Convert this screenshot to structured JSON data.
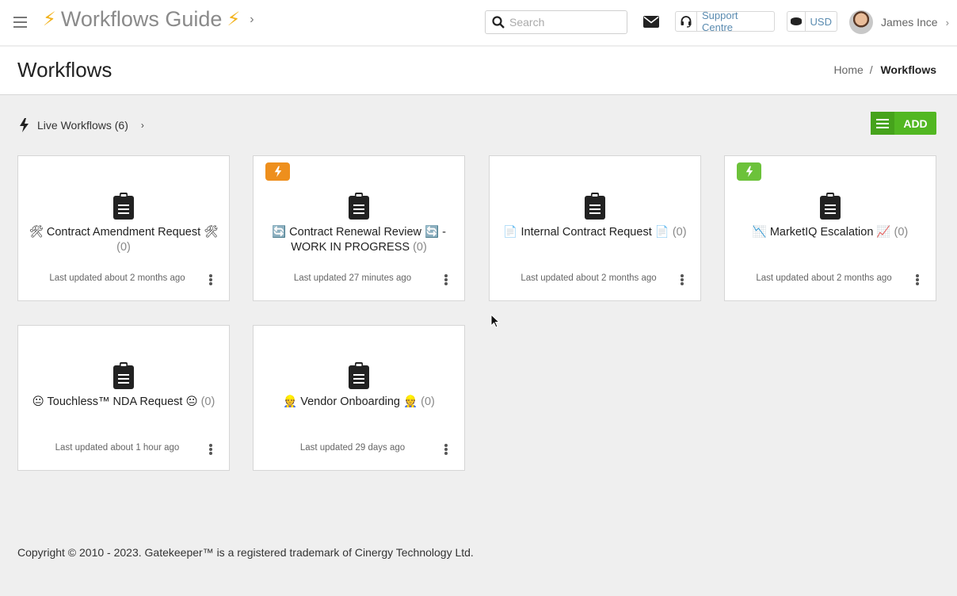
{
  "header": {
    "app_title": "Workflows Guide",
    "title_icon": "lightning-bolt",
    "search_placeholder": "Search",
    "support_label": "Support Centre",
    "currency_label": "USD",
    "user_name": "James Ince"
  },
  "page": {
    "title": "Workflows",
    "breadcrumb": {
      "home": "Home",
      "separator": "/",
      "current": "Workflows"
    }
  },
  "toolbar": {
    "section_label": "Live Workflows (6)",
    "add_label": "ADD",
    "add_color": "#52b722"
  },
  "cards": [
    {
      "name": "🛠 Contract Amendment Request 🛠",
      "count": "(0)",
      "updated": "Last updated about 2 months ago",
      "badge": ""
    },
    {
      "name": "🔄 Contract Renewal Review 🔄 - WORK IN PROGRESS",
      "count": "(0)",
      "updated": "Last updated 27 minutes ago",
      "badge": "orange"
    },
    {
      "name": "📄 Internal Contract Request 📄",
      "count": "(0)",
      "updated": "Last updated about 2 months ago",
      "badge": ""
    },
    {
      "name": "📉 MarketIQ Escalation 📈",
      "count": "(0)",
      "updated": "Last updated about 2 months ago",
      "badge": "green"
    },
    {
      "name": "😐 Touchless™ NDA Request 😐",
      "count": "(0)",
      "updated": "Last updated about 1 hour ago",
      "badge": ""
    },
    {
      "name": "👷 Vendor Onboarding 👷",
      "count": "(0)",
      "updated": "Last updated 29 days ago",
      "badge": ""
    }
  ],
  "badge_colors": {
    "orange": "#ee8f1d",
    "green": "#6cc23a"
  },
  "footer": {
    "copyright": "Copyright © 2010 - 2023. Gatekeeper™ is a registered trademark of Cinergy Technology Ltd."
  }
}
